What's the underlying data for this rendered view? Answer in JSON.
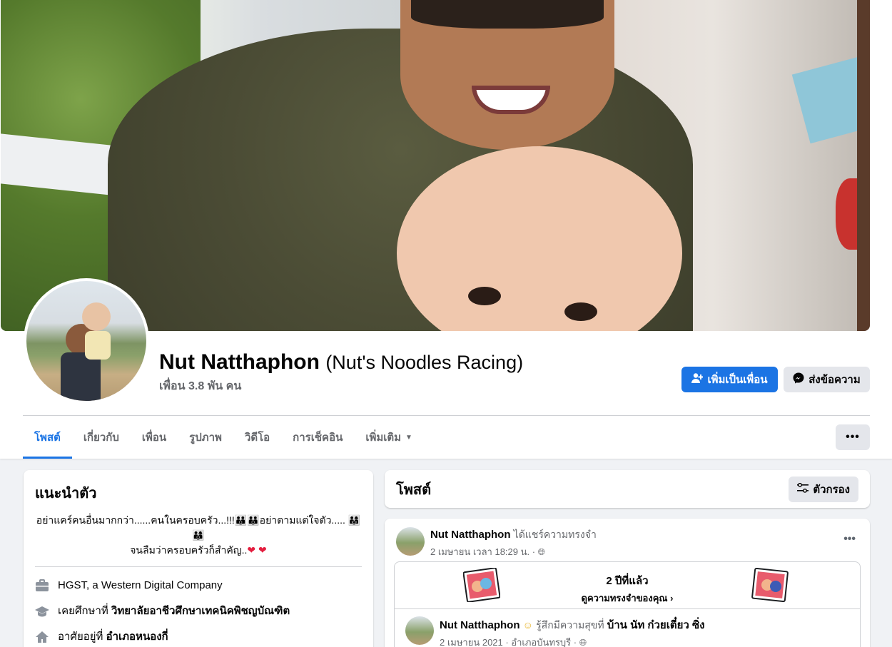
{
  "profile": {
    "name": "Nut Natthaphon",
    "nickname": "(Nut's Noodles Racing)",
    "friends": "เพื่อน 3.8 พัน คน"
  },
  "actions": {
    "add_friend": "เพิ่มเป็นเพื่อน",
    "message": "ส่งข้อความ"
  },
  "tabs": [
    {
      "label": "โพสต์",
      "active": true
    },
    {
      "label": "เกี่ยวกับ"
    },
    {
      "label": "เพื่อน"
    },
    {
      "label": "รูปภาพ"
    },
    {
      "label": "วิดีโอ"
    },
    {
      "label": "การเช็คอิน"
    },
    {
      "label": "เพิ่มเติม"
    }
  ],
  "intro": {
    "title": "แนะนำตัว",
    "bio_line1": "อย่าแคร์คนอื่นมากกว่า......คนในครอบครัว...!!!👪👪อย่าตามแต่ใจตัว..... 👨‍👩‍👧 👨‍👩‍👦",
    "bio_line2": "จนลืมว่าครอบครัวก็สำคัญ..",
    "work": "HGST, a Western Digital Company",
    "education_prefix": "เคยศึกษาที่",
    "education": "วิทยาลัยอาชีวศึกษาเทคนิคพิชญบัณฑิต",
    "lives_prefix": "อาศัยอยู่ที่",
    "lives": "อำเภอหนองกี่"
  },
  "posts": {
    "title": "โพสต์",
    "filter": "ตัวกรอง"
  },
  "post": {
    "author": "Nut Natthaphon",
    "action": "ได้แชร์ความทรงจำ",
    "date": "2 เมษายน เวลา 18:29 น. ·",
    "memory_years": "2 ปีที่แล้ว",
    "memory_link": "ดูความทรงจำของคุณ",
    "inner_author": "Nut Natthaphon",
    "inner_feeling": "รู้สึกมีความสุขที่",
    "inner_place": "บ้าน นัท ก๋วยเตี๋ยว ซิ่ง",
    "inner_date": "2 เมษายน 2021 · อำเภอบันทรบุรี ·"
  },
  "colors": {
    "accent": "#1b74e4",
    "heart": "#e41e3f"
  }
}
